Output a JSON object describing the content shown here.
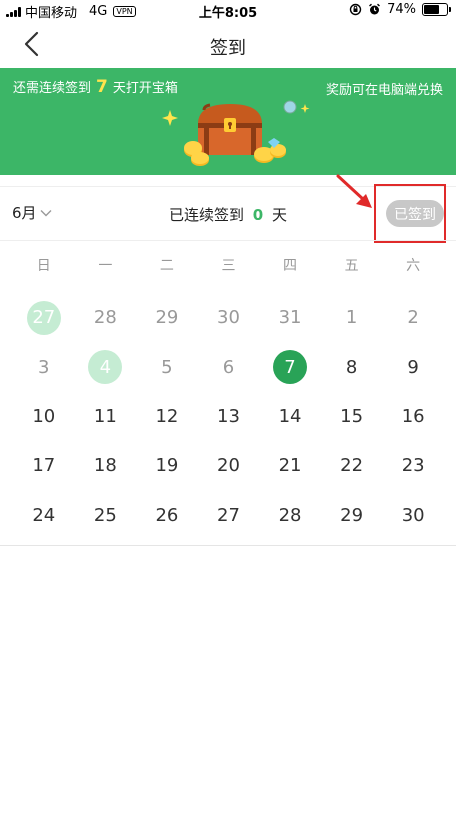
{
  "status_bar": {
    "carrier": "中国移动",
    "network": "4G",
    "vpn": "VPN",
    "time": "上午8:05",
    "battery_percent": "74%",
    "battery_level": 0.74
  },
  "nav": {
    "title": "签到"
  },
  "banner": {
    "left_prefix": "还需连续签到",
    "days_remaining": "7",
    "left_suffix": "天打开宝箱",
    "right_text": "奖励可在电脑端兑换"
  },
  "header": {
    "month_label": "6月",
    "streak_prefix": "已连续签到",
    "streak_count": "0",
    "streak_suffix": "天",
    "signed_label": "已签到"
  },
  "calendar": {
    "weekdays": [
      "日",
      "一",
      "二",
      "三",
      "四",
      "五",
      "六"
    ],
    "weeks": [
      [
        {
          "day": "27",
          "state": "marked"
        },
        {
          "day": "28",
          "state": "muted"
        },
        {
          "day": "29",
          "state": "muted"
        },
        {
          "day": "30",
          "state": "muted"
        },
        {
          "day": "31",
          "state": "muted"
        },
        {
          "day": "1",
          "state": "muted"
        },
        {
          "day": "2",
          "state": "muted"
        }
      ],
      [
        {
          "day": "3",
          "state": "muted"
        },
        {
          "day": "4",
          "state": "marked"
        },
        {
          "day": "5",
          "state": "muted"
        },
        {
          "day": "6",
          "state": "muted"
        },
        {
          "day": "7",
          "state": "today"
        },
        {
          "day": "8",
          "state": "normal"
        },
        {
          "day": "9",
          "state": "normal"
        }
      ],
      [
        {
          "day": "10",
          "state": "normal"
        },
        {
          "day": "11",
          "state": "normal"
        },
        {
          "day": "12",
          "state": "normal"
        },
        {
          "day": "13",
          "state": "normal"
        },
        {
          "day": "14",
          "state": "normal"
        },
        {
          "day": "15",
          "state": "normal"
        },
        {
          "day": "16",
          "state": "normal"
        }
      ],
      [
        {
          "day": "17",
          "state": "normal"
        },
        {
          "day": "18",
          "state": "normal"
        },
        {
          "day": "19",
          "state": "normal"
        },
        {
          "day": "20",
          "state": "normal"
        },
        {
          "day": "21",
          "state": "normal"
        },
        {
          "day": "22",
          "state": "normal"
        },
        {
          "day": "23",
          "state": "normal"
        }
      ],
      [
        {
          "day": "24",
          "state": "normal"
        },
        {
          "day": "25",
          "state": "normal"
        },
        {
          "day": "26",
          "state": "normal"
        },
        {
          "day": "27",
          "state": "normal"
        },
        {
          "day": "28",
          "state": "normal"
        },
        {
          "day": "29",
          "state": "normal"
        },
        {
          "day": "30",
          "state": "normal"
        }
      ]
    ]
  },
  "colors": {
    "brand_green": "#3CB667",
    "today_green": "#29A357",
    "marked_green": "#C5ECD3",
    "highlight_red": "#E02A2A",
    "accent_yellow": "#FFE44D"
  },
  "icons": {
    "back": "chevron-left-icon",
    "month_dropdown": "chevron-down-icon",
    "treasure": "treasure-chest-icon",
    "annotation": "arrow-icon"
  }
}
